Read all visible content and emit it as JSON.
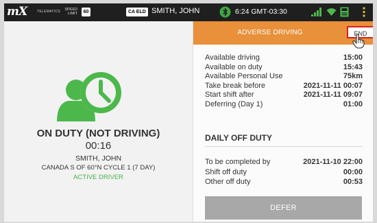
{
  "topbar": {
    "logo": "mX",
    "brand_sub": "TELEMATICS",
    "speed_label_1": "SPEED",
    "speed_label_2": "LIMIT",
    "speed_value": "60",
    "eld_badge": "CA ELD",
    "driver_name": "SMITH, JOHN",
    "time": "6:24 GMT-03:30",
    "icons": [
      "bluetooth-icon",
      "signal-icon",
      "wifi-icon",
      "save-icon",
      "menu-icon"
    ]
  },
  "status": {
    "title": "ON DUTY (NOT DRIVING)",
    "time": "00:16",
    "driver": "SMITH, JOHN",
    "cycle": "CANADA S OF 60°N CYCLE 1 (7 DAY)",
    "active": "ACTIVE DRIVER",
    "icon": "driver-clock-icon",
    "icon_color": "#4cb84c"
  },
  "adverse": {
    "label": "ADVERSE DRIVING",
    "end_button": "END",
    "color": "#e8903a"
  },
  "info_rows": [
    {
      "label": "Available driving",
      "value": "15:00"
    },
    {
      "label": "Available on duty",
      "value": "15:43"
    },
    {
      "label": "Available Personal Use",
      "value": "75km"
    },
    {
      "label": "Take break before",
      "value": "2021-11-11 00:07"
    },
    {
      "label": "Start shift after",
      "value": "2021-11-11 09:07"
    },
    {
      "label": "Deferring (Day 1)",
      "value": "01:00"
    }
  ],
  "daily_off": {
    "heading": "DAILY OFF DUTY",
    "rows": [
      {
        "label": "To be completed by",
        "value": "2021-11-10 22:00"
      },
      {
        "label": "Shift off duty",
        "value": "00:00"
      },
      {
        "label": "Other off duty",
        "value": "00:53"
      }
    ]
  },
  "defer_button": "DEFER"
}
